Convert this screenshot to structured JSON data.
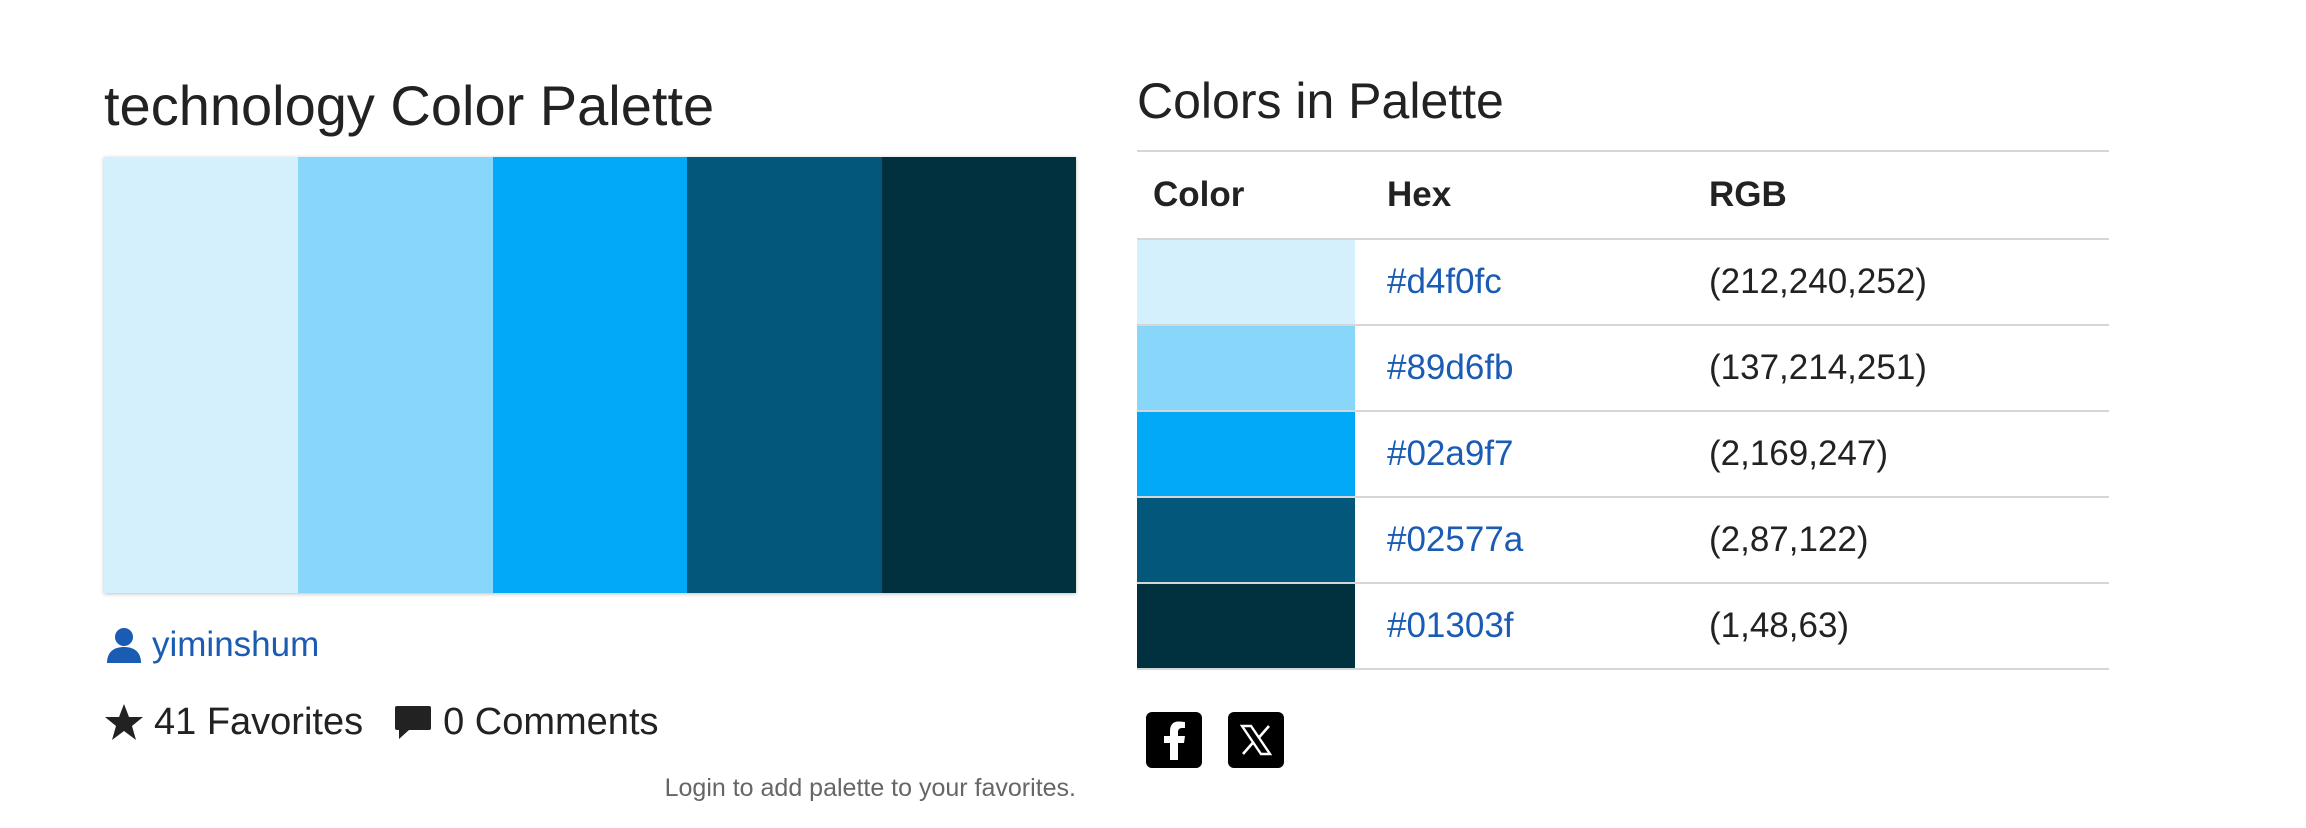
{
  "palette": {
    "title": "technology Color Palette",
    "swatches": [
      "#d4f0fc",
      "#89d6fb",
      "#02a9f7",
      "#02577a",
      "#01303f"
    ],
    "author": "yiminshum",
    "favorites_text": "41 Favorites",
    "comments_text": "0 Comments",
    "login_note": "Login to add palette to your favorites."
  },
  "colors_section": {
    "title": "Colors in Palette",
    "headers": [
      "Color",
      "Hex",
      "RGB"
    ],
    "rows": [
      {
        "hex": "#d4f0fc",
        "rgb": "(212,240,252)"
      },
      {
        "hex": "#89d6fb",
        "rgb": "(137,214,251)"
      },
      {
        "hex": "#02a9f7",
        "rgb": "(2,169,247)"
      },
      {
        "hex": "#02577a",
        "rgb": "(2,87,122)"
      },
      {
        "hex": "#01303f",
        "rgb": "(1,48,63)"
      }
    ]
  },
  "icons": {
    "user": "user-icon",
    "favorites": "star-icon",
    "comments": "comment-icon",
    "share": [
      "facebook-icon",
      "x-icon"
    ]
  },
  "colors": {
    "link": "#1a5bb4",
    "text": "#222222",
    "muted": "#666666",
    "divider": "#d6d6d6"
  }
}
